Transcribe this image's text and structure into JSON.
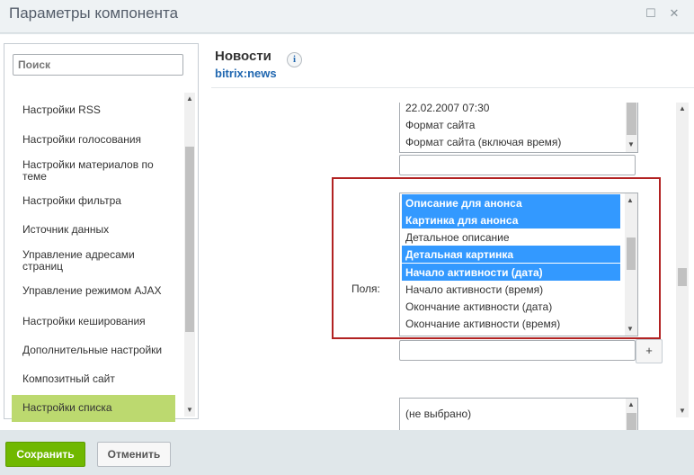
{
  "window": {
    "title": "Параметры компонента",
    "maximize_glyph": "☐",
    "close_glyph": "✕"
  },
  "sidebar": {
    "search_placeholder": "Поиск",
    "items": [
      {
        "label": "Настройки RSS"
      },
      {
        "label": "Настройки голосования"
      },
      {
        "label": "Настройки материалов по теме"
      },
      {
        "label": "Настройки фильтра"
      },
      {
        "label": "Источник данных"
      },
      {
        "label": "Управление адресами страниц"
      },
      {
        "label": "Управление режимом AJAX"
      },
      {
        "label": "Настройки кеширования"
      },
      {
        "label": "Дополнительные настройки"
      },
      {
        "label": "Композитный сайт"
      },
      {
        "label": "Настройки списка"
      }
    ],
    "active_item": "Настройки списка"
  },
  "component": {
    "title": "Новости",
    "code": "bitrix:news",
    "info_glyph": "i"
  },
  "date_format_list": {
    "options": [
      "22.02.2007 07:30",
      "Формат сайта",
      "Формат сайта (включая время)"
    ]
  },
  "fields": {
    "label": "Поля:",
    "options": [
      {
        "text": "Описание для анонса",
        "selected": true
      },
      {
        "text": "Картинка для анонса",
        "selected": true
      },
      {
        "text": "Детальное описание",
        "selected": false
      },
      {
        "text": "Детальная картинка",
        "selected": true
      },
      {
        "text": "Начало активности (дата)",
        "selected": true
      },
      {
        "text": "Начало активности (время)",
        "selected": false
      },
      {
        "text": "Окончание активности (дата)",
        "selected": false
      },
      {
        "text": "Окончание активности (время)",
        "selected": false
      }
    ],
    "add_glyph": "+"
  },
  "properties_list": {
    "options": [
      "(не выбрано)"
    ]
  },
  "footer": {
    "save_label": "Сохранить",
    "cancel_label": "Отменить"
  },
  "colors": {
    "save_button": "#70b800",
    "selection": "#3399ff",
    "active_item": "#bcd96f",
    "highlight_border": "#b22222",
    "link": "#2067b0"
  }
}
